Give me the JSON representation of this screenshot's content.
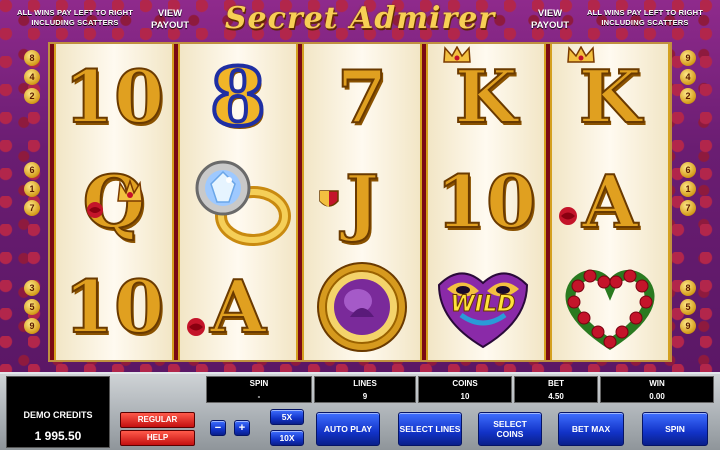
{
  "header": {
    "title": "Secret Admirer",
    "left_note": "ALL WINS PAY LEFT TO RIGHT INCLUDING SCATTERS",
    "right_note": "ALL WINS PAY LEFT TO RIGHT INCLUDING SCATTERS",
    "view_payout_left": "VIEW PAYOUT",
    "view_payout_right": "VIEW PAYOUT"
  },
  "line_markers": {
    "left": [
      "8",
      "4",
      "2",
      "6",
      "1",
      "7",
      "3",
      "5",
      "9"
    ],
    "right": [
      "9",
      "4",
      "2",
      "6",
      "1",
      "7",
      "8",
      "5",
      "9"
    ]
  },
  "reels": [
    [
      "10",
      "Q",
      "10"
    ],
    [
      "8",
      "ring",
      "A"
    ],
    [
      "7",
      "J",
      "locket"
    ],
    [
      "K",
      "10",
      "WILD"
    ],
    [
      "K",
      "A",
      "heart"
    ]
  ],
  "symbol_names": {
    "ring": "diamond-ring-icon",
    "locket": "locket-icon",
    "WILD": "wild-mask-icon",
    "heart": "rose-heart-icon"
  },
  "credits": {
    "label": "DEMO CREDITS",
    "value": "1 995.50"
  },
  "stats": {
    "spin": {
      "label": "SPIN",
      "value": "-"
    },
    "lines": {
      "label": "LINES",
      "value": "9"
    },
    "coins": {
      "label": "COINS",
      "value": "10"
    },
    "bet": {
      "label": "BET",
      "value": "4.50"
    },
    "win": {
      "label": "WIN",
      "value": "0.00"
    }
  },
  "buttons": {
    "regular": "REGULAR",
    "help": "HELP",
    "minus": "−",
    "plus": "+",
    "x5": "5X",
    "x10": "10X",
    "auto_play": "AUTO PLAY",
    "select_lines": "SELECT LINES",
    "select_coins": "SELECT COINS",
    "bet_max": "BET MAX",
    "spin": "SPIN"
  },
  "colors": {
    "frame": "#6a1d72",
    "reel_bg": "#fffaf0",
    "gold": "#e0a020",
    "button_blue": "#1233c8",
    "button_red": "#c41010"
  }
}
